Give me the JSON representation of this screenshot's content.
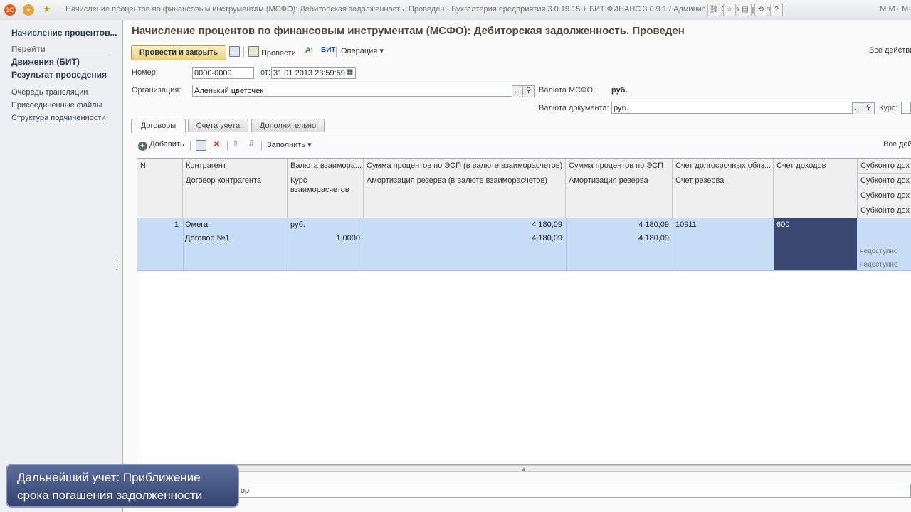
{
  "window": {
    "title": "Начисление процентов по финансовым инструментам (МСФО): Дебиторская задолженность. Проведен - Бухгалтерия предприятия 3.0.19.15 + БИТ:ФИНАНС 3.0.9.1 / Админис...   (1С:Предприятие)",
    "user": "M  M+ M-"
  },
  "leftnav": {
    "current": "Начисление процентов...",
    "goto_header": "Перейти",
    "bold_items": [
      "Движения (БИТ)",
      "Результат проведения"
    ],
    "items": [
      "Очередь трансляции",
      "Присоединенные файлы",
      "Структура подчиненности"
    ]
  },
  "doc": {
    "title": "Начисление процентов по финансовым инструментам (МСФО): Дебиторская задолженность. Проведен",
    "toolbar": {
      "post_close": "Провести и закрыть",
      "post": "Провести",
      "bit": "БИТ",
      "operation": "Операция",
      "all_actions": "Все действия"
    },
    "number_label": "Номер:",
    "number_value": "0000-0009",
    "date_label": "от:",
    "date_value": "31.01.2013 23:59:59",
    "org_label": "Организация:",
    "org_value": "Аленький цветочек",
    "msfo_currency_label": "Валюта МСФО:",
    "msfo_currency_value": "руб.",
    "doc_currency_label": "Валюта документа:",
    "doc_currency_value": "руб.",
    "rate_label": "Курс:"
  },
  "tabs": [
    "Договоры",
    "Счета учета",
    "Дополнительно"
  ],
  "table_toolbar": {
    "add": "Добавить",
    "fill": "Заполнить",
    "all_actions": "Все дей"
  },
  "grid": {
    "headers": {
      "n": "N",
      "contractor": "Контрагент",
      "contract": "Договор контрагента",
      "currency": "Валюта взаимора...",
      "rate_1": "Курс",
      "rate_2": "взаиморасчетов",
      "sum_pct_calc": "Сумма процентов по ЭСП (в валюте взаиморасчетов)",
      "amort_calc": "Амортизация резерва (в валюте взаиморасчетов)",
      "sum_pct": "Сумма процентов по ЭСП",
      "amort": "Амортизация резерва",
      "long_acc": "Счет долгосрочных обяз...",
      "reserve_acc": "Счет резерва",
      "income_acc": "Счет доходов",
      "subconto": [
        "Субконто дох",
        "Субконто дох",
        "Субконто дох",
        "Субконто дох"
      ]
    },
    "row": {
      "n": "1",
      "contractor": "Омега",
      "contract": "Договор №1",
      "currency": "руб.",
      "rate": "1,0000",
      "sum_pct_calc": "4 180,09",
      "amort_calc": "4 180,09",
      "sum_pct": "4 180,09",
      "amort": "4 180,09",
      "long_acc": "10911",
      "income_acc": "600",
      "unavailable_1": "недоступно",
      "unavailable_2": "недоступно"
    }
  },
  "bottom_field_label": "тор",
  "overlay": {
    "line1": "Дальнейший учет: Приближение",
    "line2": "срока погашения задолженности"
  }
}
